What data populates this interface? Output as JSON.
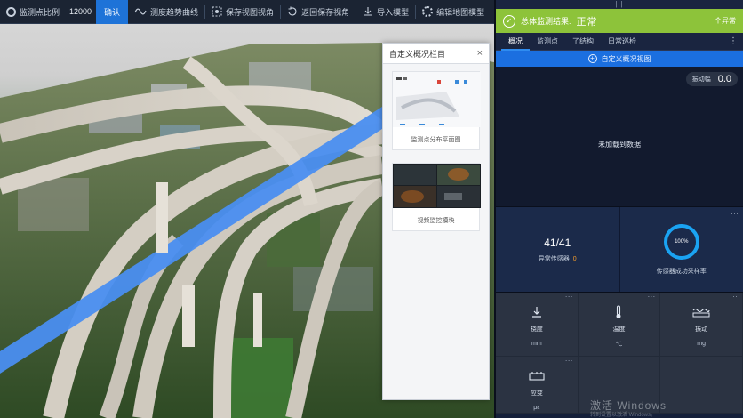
{
  "toolbar": {
    "scale_label": "监测点比例",
    "scale_value": "12000",
    "confirm": "确认",
    "items": [
      "测度趋势曲线",
      "保存视图视角",
      "返回保存视角",
      "导入模型",
      "编辑地图模型"
    ]
  },
  "custom_panel": {
    "title": "自定义概况栏目",
    "close": "×",
    "cards": [
      {
        "label": "监测点分布平面图",
        "thumb": "floorplan"
      },
      {
        "label": "视频监控模块",
        "thumb": "video"
      }
    ]
  },
  "dashboard": {
    "handle": "|||",
    "status_label": "总体监测结果:",
    "status_value": "正常",
    "status_right": "个异常",
    "tabs": [
      "概况",
      "监测点",
      "了结构",
      "日常巡检"
    ],
    "tabs_more": "⋮",
    "add_view": "自定义概况视图",
    "amplitude_label": "振动幅",
    "amplitude_value": "0.0",
    "no_data": "未加载到数据",
    "stats": {
      "count": "41/41",
      "abnormal_label": "异常传感器",
      "abnormal_value": "0",
      "ring_value": "100%",
      "ring_caption": "传感器成功采样率",
      "ring_fill": 1.0
    },
    "sensors": [
      {
        "name": "挠度",
        "unit": "mm",
        "icon": "deflection-icon"
      },
      {
        "name": "温度",
        "unit": "℃",
        "icon": "thermometer-icon"
      },
      {
        "name": "振动",
        "unit": "mg",
        "icon": "vibration-icon"
      },
      {
        "name": "应变",
        "unit": "με",
        "icon": "strain-gauge-icon"
      }
    ],
    "dots": "···"
  },
  "watermark": {
    "line1": "激活 Windows",
    "line2": "转到设置以激活 Windows。"
  }
}
